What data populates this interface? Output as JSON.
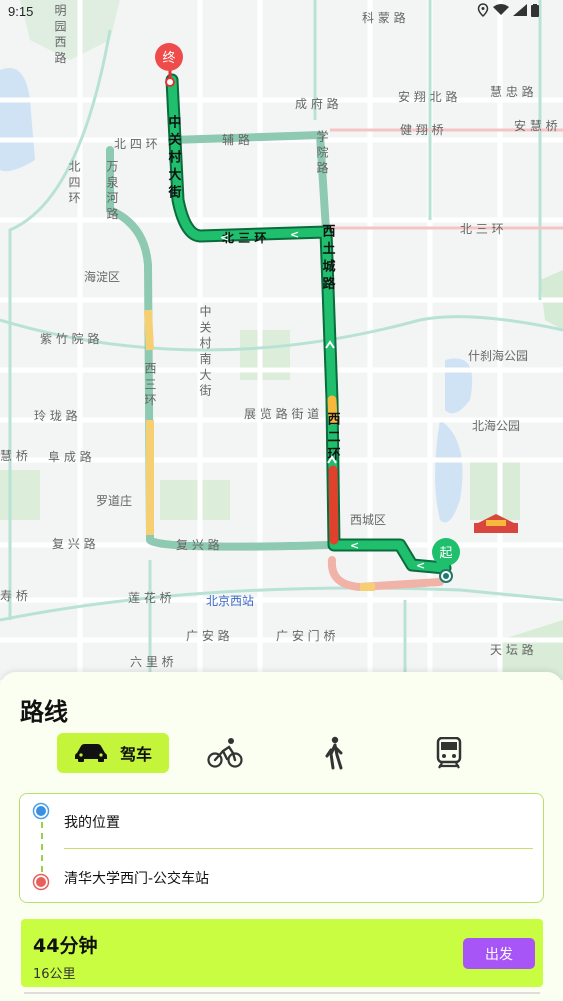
{
  "status_bar": {
    "time": "9:15"
  },
  "map": {
    "labels": {
      "keyuan": "科 蒙 路",
      "yuanmingyuan": "明 园 西 路",
      "chengfu": "成 府 路",
      "anxiang": "安 翔 北 路",
      "huizhong": "慧 忠 路",
      "jianxiang": "健 翔 桥",
      "anhui": "安 慧 桥",
      "beisihuan": "北 四 环",
      "fulu": "辅 路",
      "xueyuan": "学 院 路",
      "zhongguancun": "中 关 村 大 街",
      "beisanhuan_left": "北 三 环",
      "beisanhuan_right": "北 三 环",
      "xitucheng": "西 土 城 路",
      "wanquanhe": "万 泉 河 路",
      "beisihuan_west": "北 四 环",
      "haidian": "海淀区",
      "zizhuyuan": "紫 竹 院 路",
      "zhongguancun_south": "中 关 村 南 大 街",
      "shichahai": "什刹海公园",
      "xisanhuan": "西 三 环",
      "linglong": "玲 珑 路",
      "zhanlan": "展 览 路 街 道",
      "beihai": "北海公园",
      "xierhuan": "西 二 环",
      "jinqiao": "慧 桥",
      "fucheng": "阜 成 路",
      "luodaozhuang": "罗道庄",
      "xicheng": "西城区",
      "fuxing_left": "复 兴 路",
      "fuxing_right": "复 兴 路",
      "wukesong": "寿 桥",
      "lianhuachi": "莲 花 桥",
      "beijingxi": "北京西站",
      "guanganlu": "广 安 路",
      "guanganmen": "广 安 门 桥",
      "liuliqiao": "六 里 桥",
      "tiantanlu": "天 坛 路"
    },
    "markers": {
      "start": "起",
      "end": "终"
    }
  },
  "sheet": {
    "title": "路线",
    "modes": {
      "drive_label": "驾车"
    },
    "origin": "我的位置",
    "destination": "清华大学西门-公交车站",
    "result": {
      "duration": "44分钟",
      "distance": "16公里",
      "go_label": "出发"
    }
  },
  "colors": {
    "accent": "#c4f53a",
    "route": "#1fbf6e",
    "go_button": "#a855f7"
  }
}
